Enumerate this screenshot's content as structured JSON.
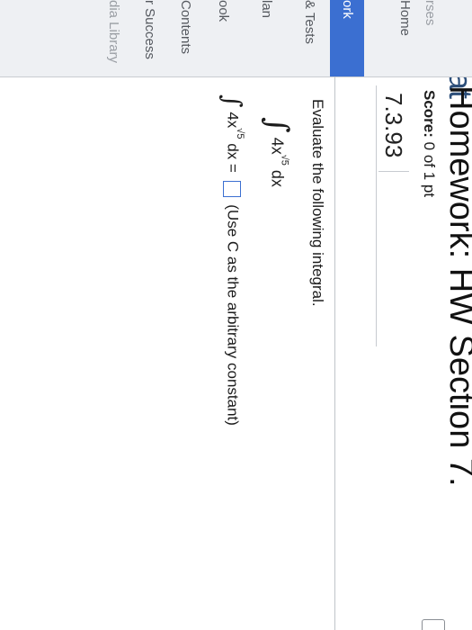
{
  "header": {
    "brand": "ab Mat",
    "title": "Homework: HW Section 7."
  },
  "sidebar": {
    "items": [
      {
        "label": "rses"
      },
      {
        "label": "Home"
      },
      {
        "label": "ork"
      },
      {
        "label": "& Tests"
      },
      {
        "label": "lan"
      },
      {
        "label": "ook"
      },
      {
        "label": "Contents"
      },
      {
        "label": "r Success"
      },
      {
        "label": "dia Library"
      }
    ]
  },
  "question": {
    "score_label": "Score:",
    "score_value": "0 of 1 pt",
    "number": "7.3.93",
    "instruction": "Evaluate the following integral.",
    "integral_symbol": "∫",
    "integrand_base": "4x",
    "integrand_exponent": "√5",
    "integrand_dx": "dx",
    "answer_equals": "dx =",
    "answer_note": "(Use C as the arbitrary constant)"
  }
}
